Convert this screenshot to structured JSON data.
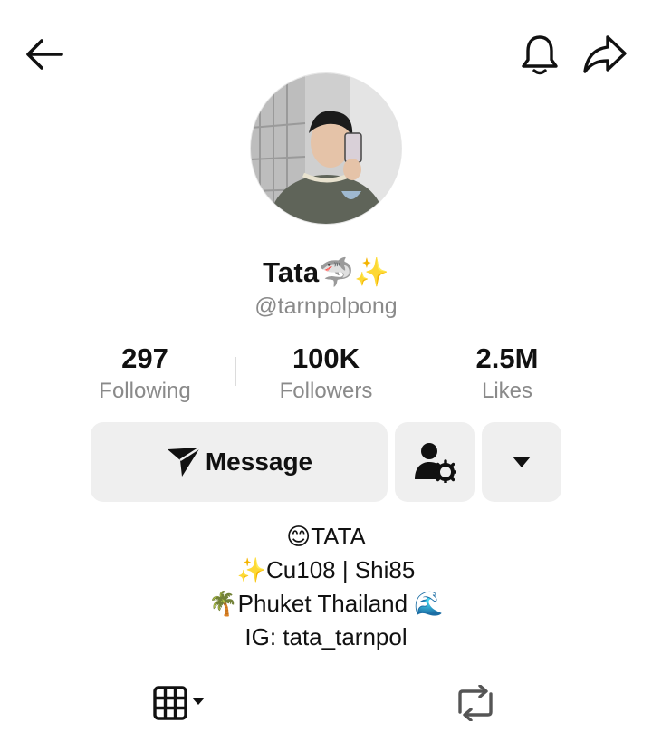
{
  "header": {
    "back_icon": "arrow-left-icon",
    "notification_icon": "bell-icon",
    "share_icon": "share-arrow-icon"
  },
  "profile": {
    "display_name": "Tata",
    "name_emojis": "🦈✨",
    "username": "@tarnpolpong"
  },
  "stats": [
    {
      "value": "297",
      "label": "Following"
    },
    {
      "value": "100K",
      "label": "Followers"
    },
    {
      "value": "2.5M",
      "label": "Likes"
    }
  ],
  "actions": {
    "message_label": "Message",
    "message_icon": "send-icon",
    "settings_icon": "person-gear-icon",
    "more_icon": "caret-down-icon",
    "button_bg": "#efefef"
  },
  "bio": [
    {
      "emoji": "😊",
      "text": "TATA",
      "emoji_after": ""
    },
    {
      "emoji": "✨",
      "text": "Cu108 | Shi85",
      "emoji_after": ""
    },
    {
      "emoji": "🌴",
      "text": "Phuket Thailand ",
      "emoji_after": "🌊"
    },
    {
      "emoji": "",
      "text": "IG: tata_tarnpol",
      "emoji_after": ""
    }
  ],
  "tabs": {
    "videos_icon": "grid-icon",
    "reposts_icon": "repost-icon"
  },
  "colors": {
    "text_primary": "#111111",
    "text_secondary": "#8a8a8a",
    "divider": "#dcdcdc"
  }
}
